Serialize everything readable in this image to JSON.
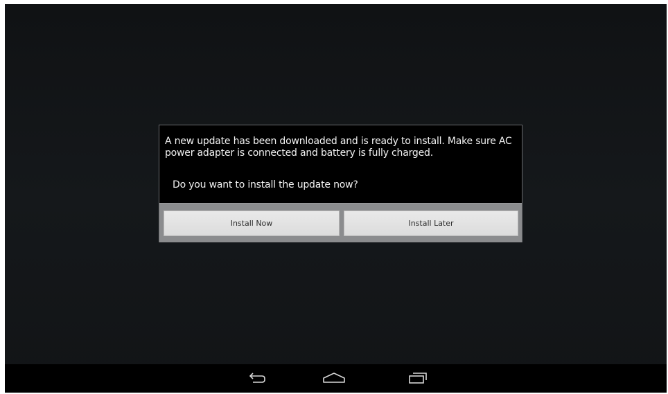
{
  "dialog": {
    "message": "A new update has been downloaded and is ready to install. Make sure AC power adapter is connected and battery is fully charged.",
    "question": "Do you want to install the update now?",
    "buttons": {
      "install_now": "Install Now",
      "install_later": "Install Later"
    }
  },
  "navbar": {
    "icons": [
      "back-icon",
      "home-icon",
      "recent-apps-icon"
    ]
  },
  "colors": {
    "dialog_background": "#000000",
    "button_bar": "#8b8c8e",
    "button_face": "#e3e3e3",
    "screen_background": "#131618",
    "navbar": "#000000"
  }
}
